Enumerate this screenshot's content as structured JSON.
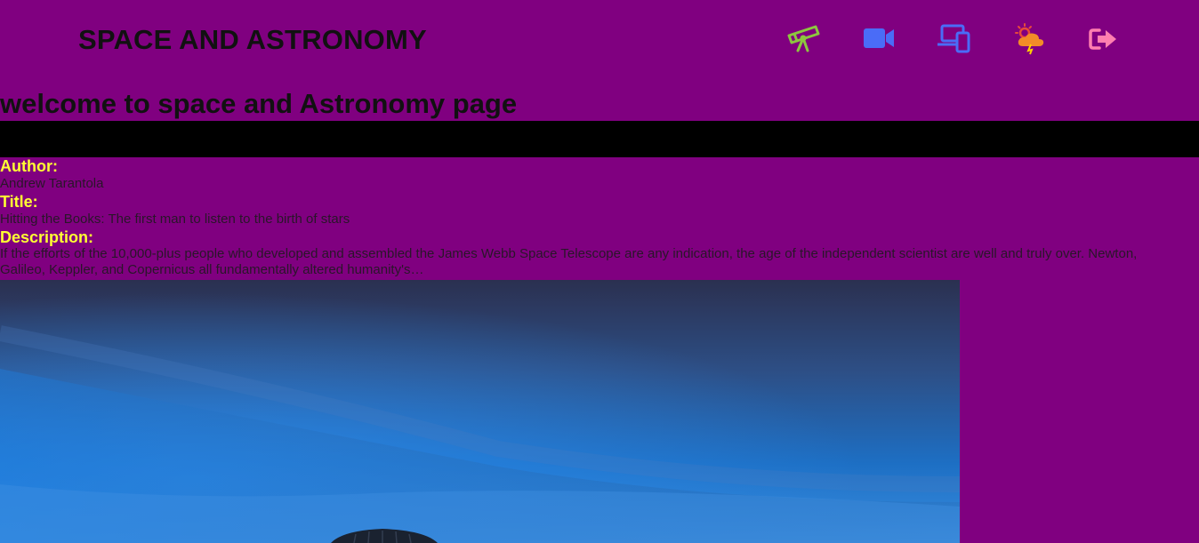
{
  "header": {
    "title": "SPACE AND ASTRONOMY",
    "icons": [
      {
        "name": "telescope-icon",
        "color": "#8dc63f"
      },
      {
        "name": "video-camera-icon",
        "color": "#4a6cf7"
      },
      {
        "name": "devices-icon",
        "color": "#4a6cf7"
      },
      {
        "name": "weather-storm-icon",
        "color": "#f28c28"
      },
      {
        "name": "sign-out-icon",
        "color": "#ff7fb0"
      }
    ]
  },
  "page": {
    "heading": "welcome to space and Astronomy page"
  },
  "article": {
    "author_label": "Author:",
    "author": "Andrew Tarantola",
    "title_label": "Title:",
    "title": "Hitting the Books: The first man to listen to the birth of stars",
    "description_label": "Description:",
    "description": "If the efforts of the 10,000-plus people who developed and assembled the James Webb Space Telescope are any indication, the age of the independent scientist are well and truly over. Newton, Galileo, Keppler, and Copernicus all fundamentally altered humanity's…"
  },
  "colors": {
    "background": "#800080",
    "label": "#ffff33",
    "bar": "#000000"
  }
}
